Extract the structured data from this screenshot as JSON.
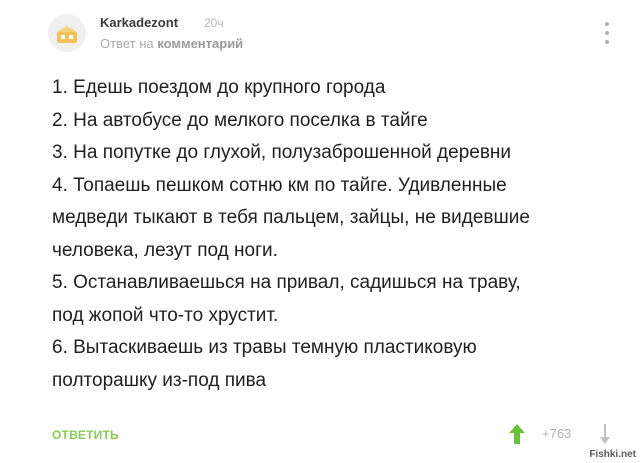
{
  "comment": {
    "username": "Karkadezont",
    "time": "20ч",
    "reply_prefix": "Ответ на",
    "reply_target": "комментарий",
    "lines": [
      "1. Едешь поездом до крупного города",
      "2. На автобусе до мелкого поселка в тайге",
      "3. На попутке до глухой, полузаброшенной деревни",
      "4. Топаешь пешком сотню км по тайге. Удивленные",
      "медведи тыкают в тебя пальцем, зайцы, не видевшие",
      "человека, лезут под ноги.",
      "5. Останавливаешься на привал, садишься на траву,",
      "под жопой что-то хрустит.",
      "6. Вытаскиваешь из травы темную пластиковую",
      "полторашку из-под пива"
    ]
  },
  "footer": {
    "reply_label": "ОТВЕТИТЬ",
    "rating": "+763"
  },
  "watermark": "Fishki.net",
  "icons": {
    "avatar": "avatar-icon",
    "more": "more-vertical-icon",
    "upvote": "arrow-up-icon",
    "downvote": "arrow-down-icon"
  },
  "colors": {
    "reply_accent": "#8ac858",
    "upvote": "#6dbf3e",
    "muted": "#b3b3b3"
  }
}
